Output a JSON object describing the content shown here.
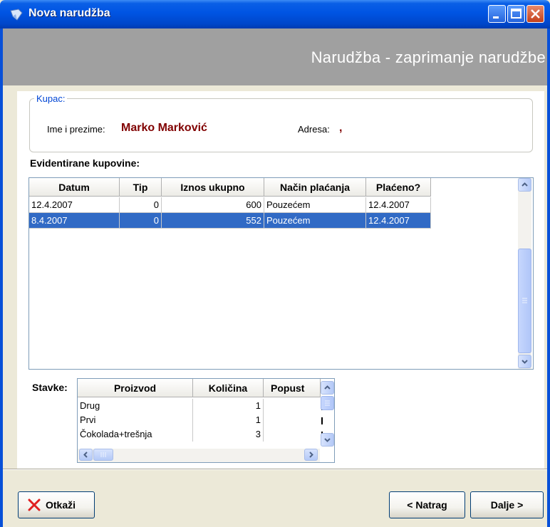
{
  "window": {
    "title": "Nova narudžba"
  },
  "header": {
    "title": "Narudžba - zaprimanje narudžbe"
  },
  "customer": {
    "legend": "Kupac:",
    "name_label": "Ime i prezime:",
    "name_value": "Marko Marković",
    "address_label": "Adresa:",
    "address_value": ","
  },
  "purchases": {
    "label": "Evidentirane kupovine:",
    "columns": [
      "Datum",
      "Tip",
      "Iznos ukupno",
      "Način plaćanja",
      "Plaćeno?"
    ],
    "rows": [
      {
        "datum": "12.4.2007",
        "tip": "0",
        "iznos": "600",
        "nacin": "Pouzećem",
        "placeno": "12.4.2007",
        "selected": false
      },
      {
        "datum": "8.4.2007",
        "tip": "0",
        "iznos": "552",
        "nacin": "Pouzećem",
        "placeno": "12.4.2007",
        "selected": true
      }
    ]
  },
  "items": {
    "label": "Stavke:",
    "columns": [
      "Proizvod",
      "Količina",
      "Popust"
    ],
    "rows": [
      {
        "proizvod": "Drug",
        "kolicina": "1"
      },
      {
        "proizvod": "Prvi",
        "kolicina": "1"
      },
      {
        "proizvod": "Čokolada+trešnja",
        "kolicina": "3"
      }
    ]
  },
  "buttons": {
    "cancel": "Otkaži",
    "back": "< Natrag",
    "next": "Dalje >"
  }
}
